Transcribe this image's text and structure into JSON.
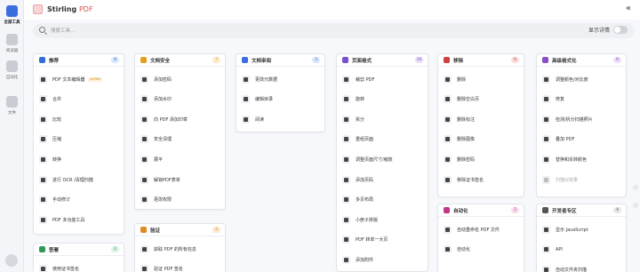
{
  "colors": {
    "accent": "#3b6fe0",
    "background": "#f7f8fb"
  },
  "app": {
    "logo_text": "Stirling",
    "logo_suffix": "PDF",
    "collapse_glyph": "«"
  },
  "rail": [
    {
      "label": "全部工具",
      "icon": "grid-icon",
      "active": true
    },
    {
      "label": "阅读器",
      "icon": "reader-icon",
      "active": false
    },
    {
      "label": "自动化",
      "icon": "automate-icon",
      "active": false
    },
    {
      "label": "文件",
      "icon": "files-icon",
      "active": false
    }
  ],
  "search": {
    "placeholder": "搜索工具...",
    "detail_label": "显示详情"
  },
  "cards": [
    {
      "title": "推荐",
      "count": "8",
      "color": "#2f6fd6",
      "badge_bg": "#dbe7fb",
      "items": [
        {
          "label": "PDF 文本编辑器",
          "beta": "ALPHA"
        },
        {
          "label": "合并"
        },
        {
          "label": "比较"
        },
        {
          "label": "压缩"
        },
        {
          "label": "转换"
        },
        {
          "label": "进行 OCR /清理扫描"
        },
        {
          "label": "手动修订"
        },
        {
          "label": "PDF 多功能工具"
        }
      ]
    },
    {
      "title": "文档安全",
      "count": "7",
      "color": "#e0a020",
      "badge_bg": "#fbeccc",
      "items": [
        {
          "label": "添加密码"
        },
        {
          "label": "添加水印"
        },
        {
          "label": "向 PDF 添加印章"
        },
        {
          "label": "安全清理"
        },
        {
          "label": "展平"
        },
        {
          "label": "解锁PDF表单"
        },
        {
          "label": "更改权限"
        }
      ]
    },
    {
      "title": "文档审阅",
      "count": "3",
      "color": "#3b6fe0",
      "badge_bg": "#dde6fa",
      "items": [
        {
          "label": "更改元数据"
        },
        {
          "label": "编辑目录"
        },
        {
          "label": "阅读"
        }
      ]
    },
    {
      "title": "页面格式",
      "count": "10",
      "color": "#7a4fd0",
      "badge_bg": "#e8e0f8",
      "items": [
        {
          "label": "裁剪 PDF"
        },
        {
          "label": "旋转"
        },
        {
          "label": "拆分"
        },
        {
          "label": "重组页面"
        },
        {
          "label": "调整页面尺寸/缩放"
        },
        {
          "label": "添加页码"
        },
        {
          "label": "多页布局"
        },
        {
          "label": "小册子拼版"
        },
        {
          "label": "PDF 转单一大页"
        },
        {
          "label": "添加附件"
        }
      ]
    },
    {
      "title": "移除",
      "count": "6",
      "color": "#d04040",
      "badge_bg": "#f8dede",
      "items": [
        {
          "label": "删除"
        },
        {
          "label": "删除空白页"
        },
        {
          "label": "删除标注"
        },
        {
          "label": "删除图像"
        },
        {
          "label": "删除密码"
        },
        {
          "label": "移除证书签名"
        }
      ]
    },
    {
      "title": "高级格式化",
      "count": "6",
      "color": "#8a4fc8",
      "badge_bg": "#ece0f8",
      "items": [
        {
          "label": "调整颜色/对比度"
        },
        {
          "label": "修复"
        },
        {
          "label": "检测/拆分扫描照片"
        },
        {
          "label": "叠加 PDF"
        },
        {
          "label": "替换和反转颜色"
        },
        {
          "label": "扫描仪效果",
          "dim": true
        }
      ]
    },
    {
      "title": "签署",
      "count": "2",
      "color": "#2f9a5a",
      "badge_bg": "#dcf1e4",
      "items": [
        {
          "label": "使用证书签名"
        }
      ]
    },
    {
      "title": "验证",
      "count": "2",
      "color": "#e08a20",
      "badge_bg": "#fbe8cf",
      "items": [
        {
          "label": "获取 PDF 的所有信息"
        },
        {
          "label": "验证 PDF 签名"
        }
      ]
    },
    {
      "title": "自动化",
      "count": "2",
      "color": "#c0388a",
      "badge_bg": "#f6dcec",
      "items": [
        {
          "label": "自动重命名 PDF 文件"
        },
        {
          "label": "自动化"
        }
      ]
    },
    {
      "title": "开发者专区",
      "count": "4",
      "color": "#555555",
      "badge_bg": "#e6e7ea",
      "items": [
        {
          "label": "显示 JavaScript"
        },
        {
          "label": "API"
        },
        {
          "label": "自动文件夹扫描"
        }
      ]
    }
  ]
}
